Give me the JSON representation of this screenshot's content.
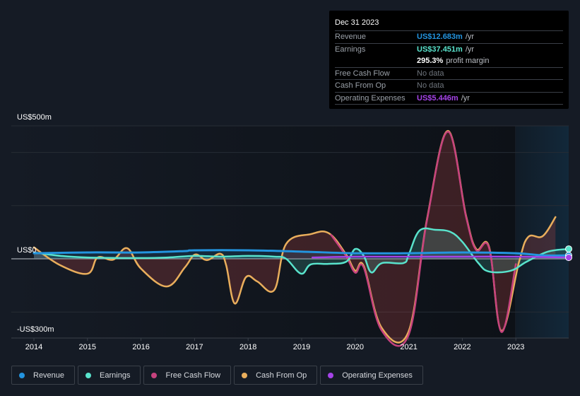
{
  "tooltip": {
    "date": "Dec 31 2023",
    "rows": [
      {
        "label": "Revenue",
        "value": "US$12.683m",
        "unit": "/yr",
        "color": "#2394df"
      },
      {
        "label": "Earnings",
        "value": "US$37.451m",
        "unit": "/yr",
        "color": "#59e3cc"
      },
      {
        "label": "",
        "value": "295.3%",
        "unit": "profit margin",
        "color": "#ffffff"
      },
      {
        "label": "Free Cash Flow",
        "value": "No data",
        "unit": "",
        "color": "#6f757d"
      },
      {
        "label": "Cash From Op",
        "value": "No data",
        "unit": "",
        "color": "#6f757d"
      },
      {
        "label": "Operating Expenses",
        "value": "US$5.446m",
        "unit": "/yr",
        "color": "#a543e8"
      }
    ]
  },
  "legend": [
    {
      "label": "Revenue",
      "color": "#2394df"
    },
    {
      "label": "Earnings",
      "color": "#59e3cc"
    },
    {
      "label": "Free Cash Flow",
      "color": "#c6427e"
    },
    {
      "label": "Cash From Op",
      "color": "#e9ae5c"
    },
    {
      "label": "Operating Expenses",
      "color": "#a543e8"
    }
  ],
  "chart_data": {
    "type": "line",
    "title": "",
    "xlabel": "",
    "ylabel": "",
    "ylim": [
      -300,
      500
    ],
    "xlim": [
      2013.58,
      2024.0
    ],
    "y_tick_labels": [
      {
        "value": 500,
        "label": "US$500m"
      },
      {
        "value": 0,
        "label": "US$0"
      },
      {
        "value": -300,
        "label": "-US$300m"
      }
    ],
    "y_gridlines": [
      500,
      400,
      200,
      0,
      -200
    ],
    "x_ticks": [
      2014,
      2015,
      2016,
      2017,
      2018,
      2019,
      2020,
      2021,
      2022,
      2023
    ],
    "x_tick_labels": [
      "2014",
      "2015",
      "2016",
      "2017",
      "2018",
      "2019",
      "2020",
      "2021",
      "2022",
      "2023"
    ],
    "forecast_region_start": 2023.0,
    "grid": true,
    "legend_position": "bottom",
    "units": "US$ millions",
    "series": [
      {
        "name": "Revenue",
        "color": "#2394df",
        "x": [
          2014.0,
          2015.0,
          2016.0,
          2016.8,
          2017.0,
          2018.0,
          2019.0,
          2020.0,
          2021.0,
          2022.0,
          2023.0,
          2023.5,
          2024.0
        ],
        "y": [
          21,
          24,
          24,
          29,
          32,
          32,
          27,
          21,
          21,
          24,
          21,
          13,
          13
        ]
      },
      {
        "name": "Earnings",
        "color": "#59e3cc",
        "x": [
          2014.0,
          2014.5,
          2015.0,
          2016.0,
          2016.5,
          2017.0,
          2017.5,
          2018.0,
          2018.5,
          2018.71,
          2018.99,
          2019.17,
          2019.5,
          2019.83,
          2020.0,
          2020.16,
          2020.3,
          2020.5,
          2020.9,
          2021.0,
          2021.2,
          2021.5,
          2021.78,
          2022.0,
          2022.3,
          2022.5,
          2022.9,
          2023.2,
          2023.6,
          2024.0
        ],
        "y": [
          24,
          11,
          5,
          3,
          5,
          11,
          8,
          11,
          8,
          0,
          -56,
          -21,
          -19,
          -11,
          37,
          11,
          -51,
          -16,
          -16,
          16,
          106,
          109,
          101,
          64,
          -16,
          -48,
          -45,
          -11,
          27,
          37
        ]
      },
      {
        "name": "Free Cash Flow",
        "color": "#c6427e",
        "x": [
          2019.55,
          2019.83,
          2020.0,
          2020.16,
          2020.49,
          2020.99,
          2021.34,
          2021.73,
          2022.07,
          2022.26,
          2022.5,
          2022.73,
          2023.0
        ],
        "y": [
          90,
          10,
          -52,
          -33,
          -268,
          -290,
          145,
          478,
          158,
          33,
          41,
          -275,
          -20
        ]
      },
      {
        "name": "Cash From Op",
        "color": "#e9ae5c",
        "x": [
          2014.0,
          2014.49,
          2015.0,
          2015.19,
          2015.48,
          2015.74,
          2016.0,
          2016.48,
          2016.82,
          2017.01,
          2017.23,
          2017.48,
          2017.59,
          2017.75,
          2017.96,
          2018.17,
          2018.49,
          2018.71,
          2019.17,
          2019.51,
          2019.83,
          2020.0,
          2020.16,
          2020.49,
          2020.99,
          2021.34,
          2021.73,
          2022.07,
          2022.26,
          2022.5,
          2022.73,
          2023.06,
          2023.23,
          2023.5,
          2023.74
        ],
        "y": [
          43,
          -24,
          -56,
          5,
          -3,
          40,
          -37,
          -104,
          -32,
          16,
          -5,
          19,
          -24,
          -168,
          -69,
          -85,
          -117,
          56,
          93,
          96,
          16,
          -45,
          -27,
          -258,
          -277,
          149,
          481,
          162,
          37,
          45,
          -271,
          -11,
          82,
          85,
          157
        ]
      },
      {
        "name": "Operating Expenses",
        "color": "#a543e8",
        "x": [
          2019.2,
          2020.0,
          2021.0,
          2022.0,
          2023.0,
          2024.0
        ],
        "y": [
          5,
          8,
          8,
          8,
          8,
          5
        ]
      }
    ]
  }
}
